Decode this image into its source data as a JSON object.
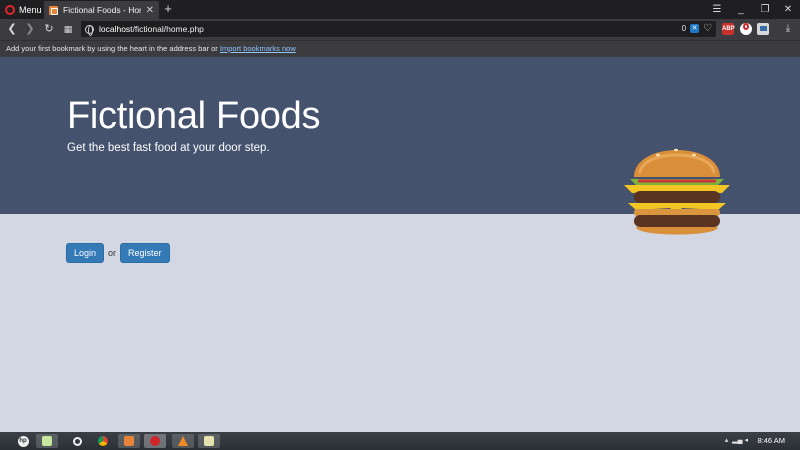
{
  "browser": {
    "menu_label": "Menu",
    "tab_title": "Fictional Foods - Home",
    "url_host": "localhost",
    "url_path": "/fictional/home.php",
    "blocked_count": "0",
    "bookmark_message": "Add your first bookmark by using the heart in the address bar or",
    "bookmark_link": "Import bookmarks now",
    "extensions": [
      "abp-icon",
      "opera-vpn-icon",
      "flow-icon"
    ]
  },
  "hero": {
    "title": "Fictional Foods",
    "subtitle": "Get the best fast food at your door step."
  },
  "auth": {
    "login_label": "Login",
    "or_text": "or",
    "register_label": "Register"
  },
  "taskbar": {
    "clock": "8:46 AM",
    "apps": [
      "hp-icon",
      "file-explorer-icon",
      "opera-icon",
      "chrome-icon",
      "xampp-icon",
      "opera-active-icon",
      "vlc-icon",
      "notes-icon"
    ]
  },
  "colors": {
    "hero_bg": "#44526e",
    "page_bg": "#d2d7e3",
    "button_bg": "#337ab7",
    "chrome_bg": "#3c3c40"
  }
}
